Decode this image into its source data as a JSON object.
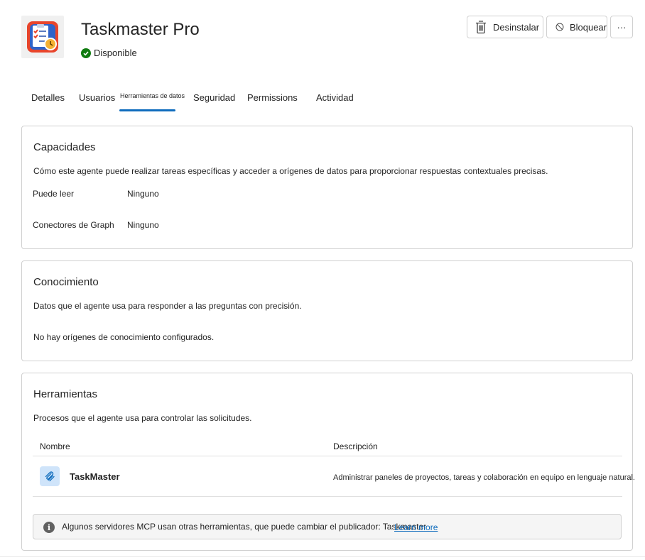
{
  "app": {
    "title": "Taskmaster Pro",
    "status": "Disponible",
    "icon": "taskmaster-app-icon"
  },
  "actions": {
    "uninstall_label": "Desinstalar",
    "block_label": "Bloquear",
    "more_label": "···"
  },
  "tabs": [
    {
      "label": "Detalles"
    },
    {
      "label": "Usuarios"
    },
    {
      "label": "Herramientas de datos",
      "selected": true
    },
    {
      "label": "Seguridad"
    },
    {
      "label": "Permissions"
    },
    {
      "label": "Actividad"
    }
  ],
  "capabilities": {
    "title": "Capacidades",
    "description": "Cómo este agente puede realizar tareas específicas y acceder a orígenes de datos para proporcionar respuestas contextuales precisas.",
    "rows": [
      {
        "label": "Puede leer",
        "value": "Ninguno"
      },
      {
        "label": "Conectores de Graph",
        "value": "Ninguno"
      }
    ]
  },
  "knowledge": {
    "title": "Conocimiento",
    "description": "Datos que el agente usa para responder a las preguntas con precisión.",
    "empty": "No hay orígenes de conocimiento configurados."
  },
  "tools": {
    "title": "Herramientas",
    "description": "Procesos que el agente usa para controlar las solicitudes.",
    "columns": {
      "name": "Nombre",
      "description": "Descripción"
    },
    "rows": [
      {
        "name": "TaskMaster",
        "description": "Administrar paneles de proyectos, tareas y colaboración en equipo en lenguaje natural.",
        "icon": "paperclip-icon"
      }
    ],
    "info": {
      "text": "Algunos servidores MCP usan otras herramientas, que puede cambiar el publicador: Taskmaster",
      "link": "Learn more"
    }
  },
  "colors": {
    "accent": "#0f6cbd",
    "success": "#107c10",
    "border": "#d1d1d1"
  }
}
